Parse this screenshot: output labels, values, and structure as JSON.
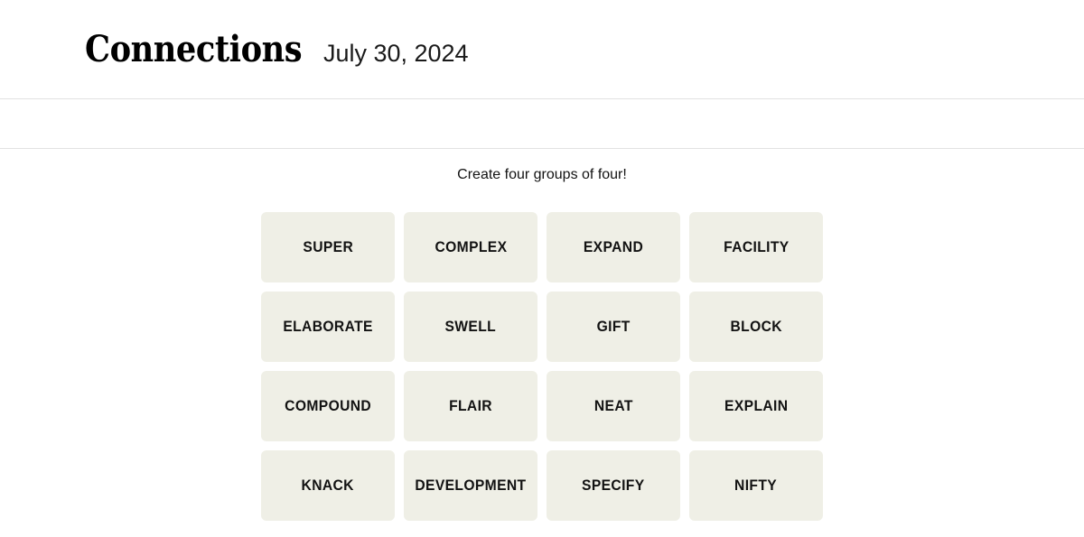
{
  "header": {
    "title": "Connections",
    "date": "July 30, 2024"
  },
  "toolbar": {
    "items": []
  },
  "main": {
    "instruction": "Create four groups of four!",
    "tiles": [
      {
        "label": "SUPER"
      },
      {
        "label": "COMPLEX"
      },
      {
        "label": "EXPAND"
      },
      {
        "label": "FACILITY"
      },
      {
        "label": "ELABORATE"
      },
      {
        "label": "SWELL"
      },
      {
        "label": "GIFT"
      },
      {
        "label": "BLOCK"
      },
      {
        "label": "COMPOUND"
      },
      {
        "label": "FLAIR"
      },
      {
        "label": "NEAT"
      },
      {
        "label": "EXPLAIN"
      },
      {
        "label": "KNACK"
      },
      {
        "label": "DEVELOPMENT"
      },
      {
        "label": "SPECIFY"
      },
      {
        "label": "NIFTY"
      }
    ]
  },
  "colors": {
    "page_background": "#ffffff",
    "tile_background": "#efefe6",
    "text": "#121212",
    "divider": "#e2e2e2"
  }
}
